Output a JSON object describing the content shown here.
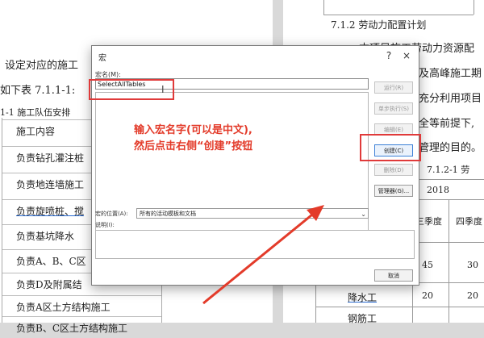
{
  "doc_left": {
    "line1": "设定对应的施工",
    "line2": "如下表 7.1.1-1:",
    "caption": "1-1 施工队伍安排",
    "rows": [
      "施工内容",
      "负责钻孔灌注桩",
      "负责地连墙施工",
      "负责旋喷桩、搅",
      "负责基坑降水",
      "负责A、B、C区",
      "负责D及附属结",
      "负责A区土方结构施工",
      "负责B、C区土方结构施工"
    ]
  },
  "doc_right": {
    "heading": "7.1.2 劳动力配置计划",
    "p1": "本项目施工劳动力资源配",
    "p2": "及高峰施工期",
    "p3": "充分利用项目",
    "p4": "全等前提下,",
    "p5": "管理的目的。",
    "table_caption": "7.1.2-1 劳",
    "year": "2018",
    "col_q3": "三季度",
    "col_q4": "四季度",
    "val_a": "45",
    "val_b": "30",
    "val_c": "20",
    "val_d": "20",
    "row_label_1": "降水工",
    "row_label_2": "钢筋工"
  },
  "dialog": {
    "title": "宏",
    "close": "×",
    "help": "?",
    "macro_name_label": "宏名(M):",
    "macro_name_value": "SelectAllTables",
    "buttons": {
      "run": "运行(R)",
      "step": "单步执行(S)",
      "edit": "编辑(E)",
      "create": "创建(C)",
      "delete": "删除(D)",
      "organizer": "管理器(G)...",
      "cancel": "取消"
    },
    "location_label": "宏的位置(A):",
    "location_value": "所有的活动模板和文档",
    "description_label": "说明(I):"
  },
  "annotation": {
    "line1": "输入宏名字(可以是中文),",
    "line2": "然后点击右侧“创建”按钮",
    "color": "#e33b2a"
  }
}
